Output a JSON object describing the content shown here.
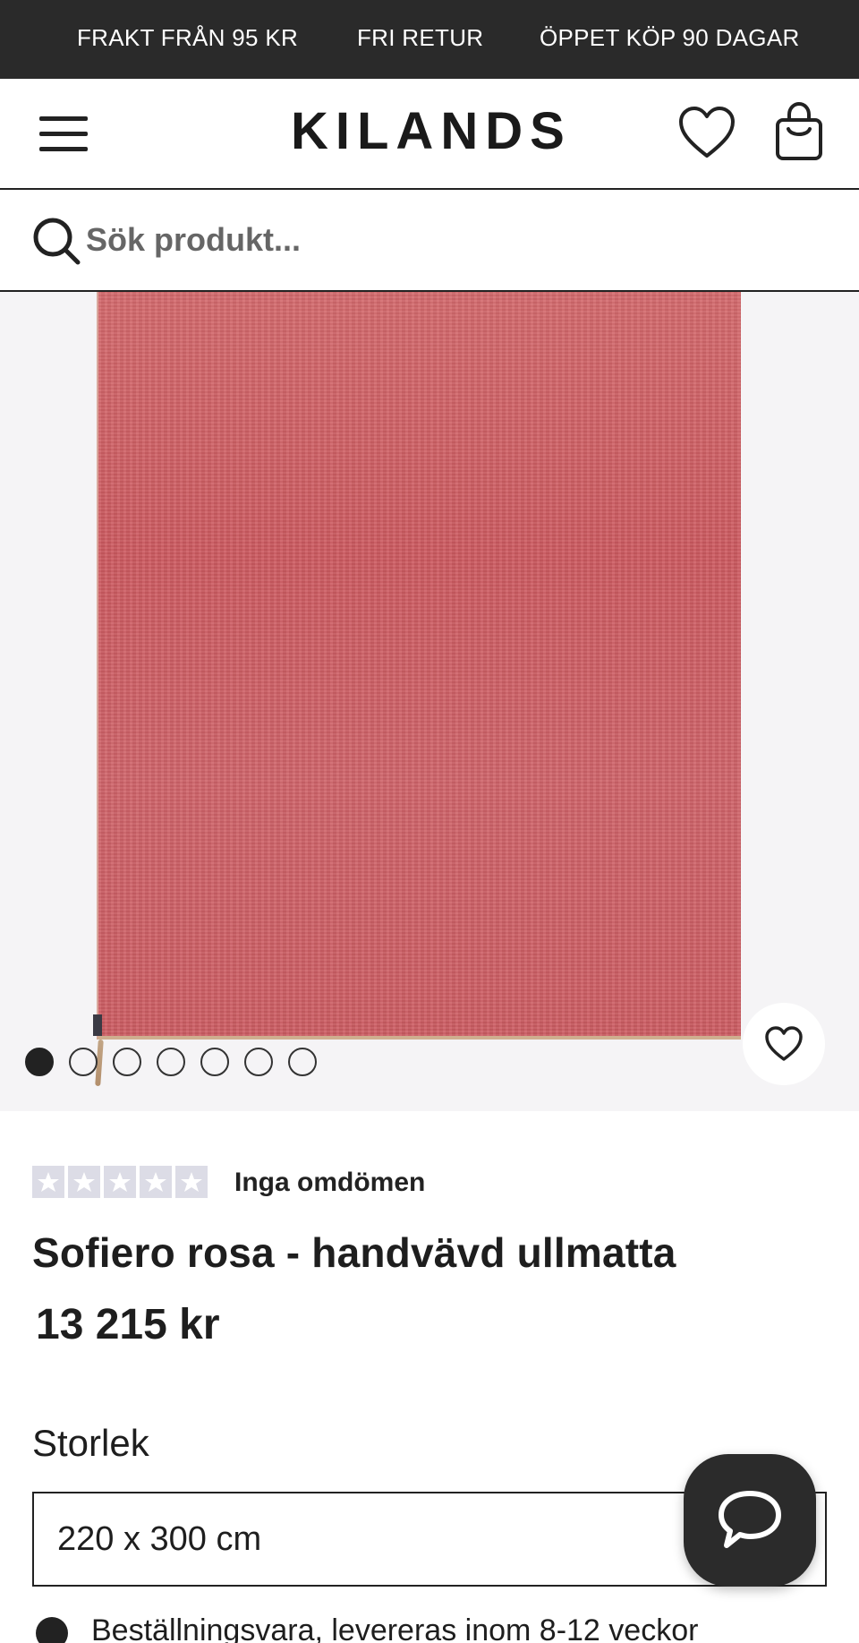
{
  "promo_bar": {
    "items": [
      "FRAKT FRÅN 95 KR",
      "FRI RETUR",
      "ÖPPET KÖP 90 DAGAR"
    ]
  },
  "header": {
    "logo": "KILANDS",
    "icons": {
      "menu": "hamburger-menu-icon",
      "wishlist": "heart-icon",
      "cart": "shopping-bag-icon"
    }
  },
  "search": {
    "placeholder": "Sök produkt..."
  },
  "gallery": {
    "image_count": 7,
    "active_index": 0,
    "product_color": "#cf5d62"
  },
  "reviews": {
    "rating": 0,
    "max": 5,
    "label": "Inga omdömen"
  },
  "product": {
    "title": "Sofiero rosa - handvävd ullmatta",
    "price": "13 215 kr"
  },
  "size": {
    "label": "Storlek",
    "selected": "220 x 300 cm"
  },
  "stock": {
    "text": "Beställningsvara, levereras inom 8-12 veckor"
  }
}
